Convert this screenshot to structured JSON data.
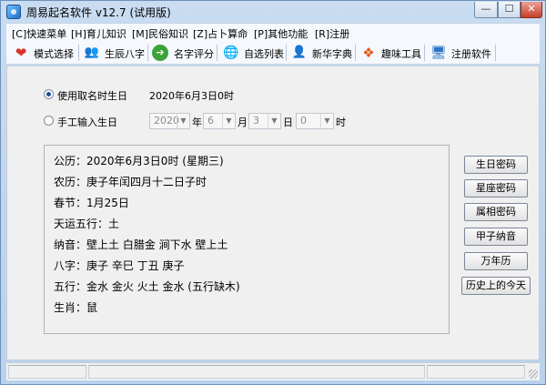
{
  "window": {
    "title": "周易起名软件 v12.7 (试用版)",
    "controls": {
      "minimize": "—",
      "maximize": "☐",
      "close": "✕"
    }
  },
  "menu": [
    "[C]快速菜单",
    "[H]育儿知识",
    "[M]民俗知识",
    "[Z]占卜算命",
    "[P]其他功能",
    "[R]注册"
  ],
  "toolbar": [
    {
      "label": "模式选择",
      "icon": "heart-icon",
      "glyph": "❤",
      "color": "#d9342b"
    },
    {
      "label": "生辰八字",
      "icon": "people-icon",
      "glyph": "👥",
      "color": "#4a6ea9"
    },
    {
      "label": "名字评分",
      "icon": "arrow-right-icon",
      "glyph": "➔",
      "color": "#2f9a2f"
    },
    {
      "label": "自选列表",
      "icon": "globe-icon",
      "glyph": "🌐",
      "color": "#2a6cc0"
    },
    {
      "label": "新华字典",
      "icon": "person-icon",
      "glyph": "👤",
      "color": "#8a5a2b"
    },
    {
      "label": "趣味工具",
      "icon": "windows-icon",
      "glyph": "❖",
      "color": "#e05a1c"
    },
    {
      "label": "注册软件",
      "icon": "monitor-icon",
      "glyph": "🖥",
      "color": "#2e74c4"
    }
  ],
  "birth_mode": {
    "option_auto": {
      "label": "使用取名时生日",
      "value": "2020年6月3日0时",
      "checked": true
    },
    "option_manual": {
      "label": "手工输入生日",
      "checked": false
    },
    "manual_fields": {
      "year": "2020",
      "year_unit": "年",
      "month": "6",
      "month_unit": "月",
      "day": "3",
      "day_unit": "日",
      "hour": "0",
      "hour_unit": "时"
    }
  },
  "info": {
    "solar": "公历：2020年6月3日0时 (星期三)",
    "lunar": "农历：庚子年闰四月十二日子时",
    "spring_festival": "春节：1月25日",
    "fortune_element": "天运五行：土",
    "nayin": "纳音：壁上土  白腊金  涧下水  壁上土",
    "bazi": "八字：庚子  辛巳  丁丑  庚子",
    "wuxing": "五行：金水  金火  火土  金水  (五行缺木)",
    "zodiac": "生肖：鼠"
  },
  "side_buttons": {
    "birthday_code": "生日密码",
    "star_code": "星座密码",
    "zodiac_code": "属相密码",
    "jiazi_nayin": "甲子纳音",
    "perpetual_calendar": "万年历",
    "history_today": "历史上的今天"
  }
}
